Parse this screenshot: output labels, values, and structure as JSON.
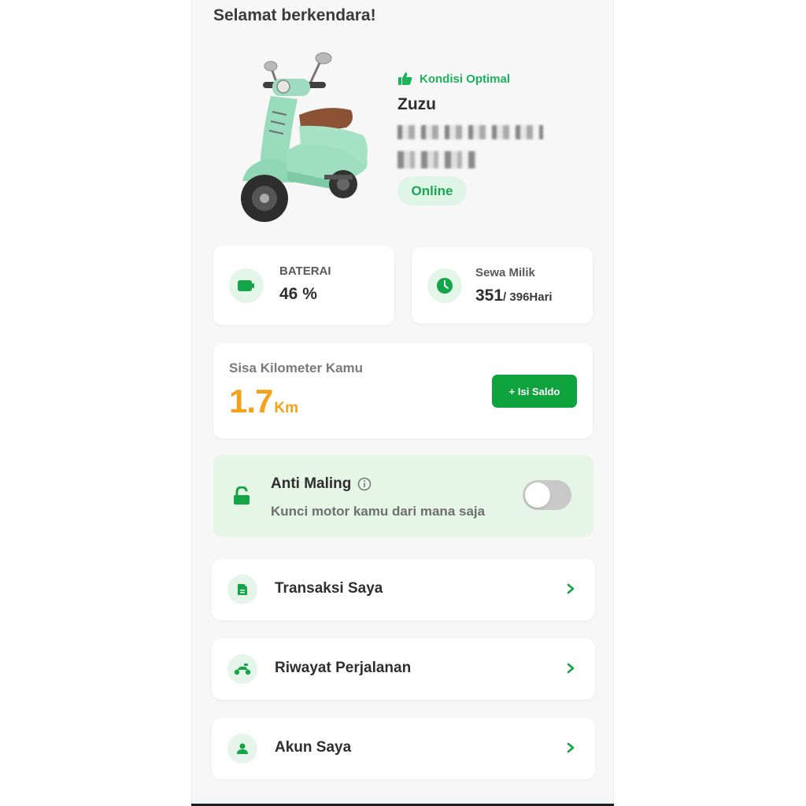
{
  "greeting": "Selamat berkendara!",
  "vehicle": {
    "condition": "Kondisi Optimal",
    "name": "Zuzu",
    "status": "Online"
  },
  "stats": {
    "battery_label": "BATERAI",
    "battery_value": "46 %",
    "rent_label": "Sewa Milik",
    "rent_current": "351",
    "rent_total": "/ 396Hari"
  },
  "km": {
    "label": "Sisa Kilometer Kamu",
    "value": "1.7",
    "unit": "Km",
    "topup_button": "+ Isi Saldo"
  },
  "anti_theft": {
    "title": "Anti Maling",
    "subtitle": "Kunci motor kamu dari mana saja",
    "enabled": false
  },
  "menu": [
    {
      "label": "Transaksi Saya",
      "icon": "document-icon"
    },
    {
      "label": "Riwayat Perjalanan",
      "icon": "scooter-icon"
    },
    {
      "label": "Akun Saya",
      "icon": "user-icon"
    }
  ],
  "colors": {
    "primary_green": "#0fa33d",
    "accent_green": "#1bb35c",
    "km_orange": "#f2a21b",
    "soft_green_bg": "#e5f5e6"
  }
}
